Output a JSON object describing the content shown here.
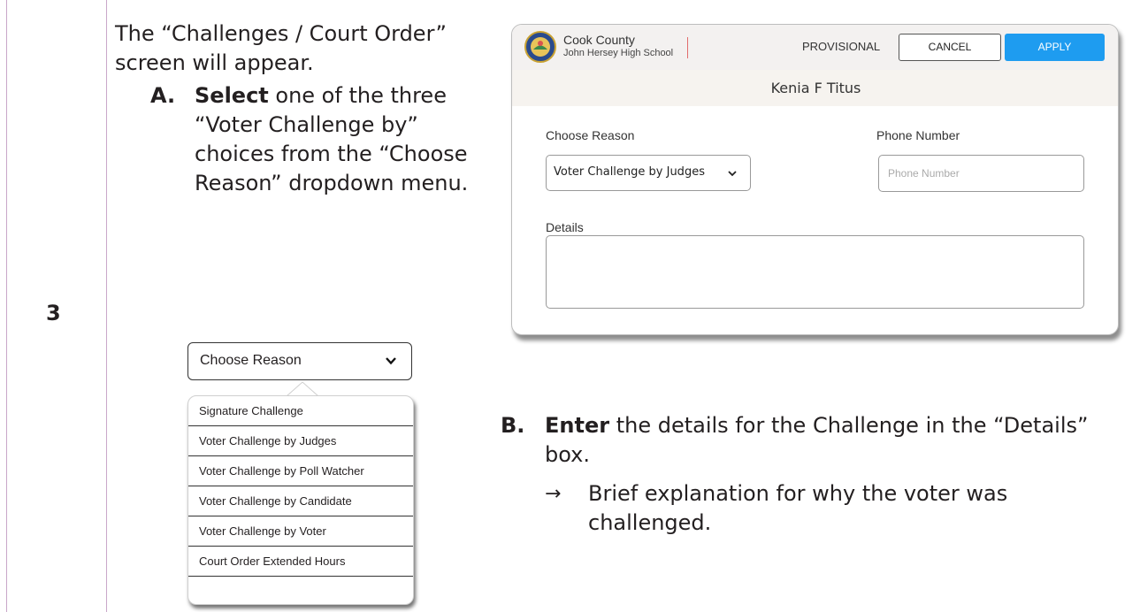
{
  "step": {
    "number": "3"
  },
  "intro": "The “Challenges / Court Order” screen will appear.",
  "item_a": {
    "letter": "A.",
    "bold": "Select",
    "text": " one of the three “Voter Challenge by” choices from the “Choose Reason” dropdown menu."
  },
  "dropdown": {
    "label": "Choose Reason",
    "options": [
      "Signature Challenge",
      "Voter Challenge by Judges",
      "Voter Challenge by Poll Watcher",
      "Voter Challenge by Candidate",
      "Voter Challenge by Voter",
      "Court Order Extended Hours"
    ]
  },
  "screen": {
    "county": "Cook County",
    "school": "John Hersey High School",
    "provisional": "PROVISIONAL",
    "cancel": "CANCEL",
    "apply": "APPLY",
    "voter_name": "Kenia F Titus",
    "reason_label": "Choose Reason",
    "reason_value": "Voter Challenge by Judges",
    "phone_label": "Phone Number",
    "phone_placeholder": "Phone Number",
    "details_label": "Details"
  },
  "item_b": {
    "letter": "B.",
    "bold": "Enter",
    "text": " the details for the Challenge in the “Details” box.",
    "sub_arrow": "→",
    "sub": "Brief explanation for why the voter was challenged."
  },
  "colors": {
    "accent": "#1e9cf0",
    "rule": "#c9a7c9"
  }
}
